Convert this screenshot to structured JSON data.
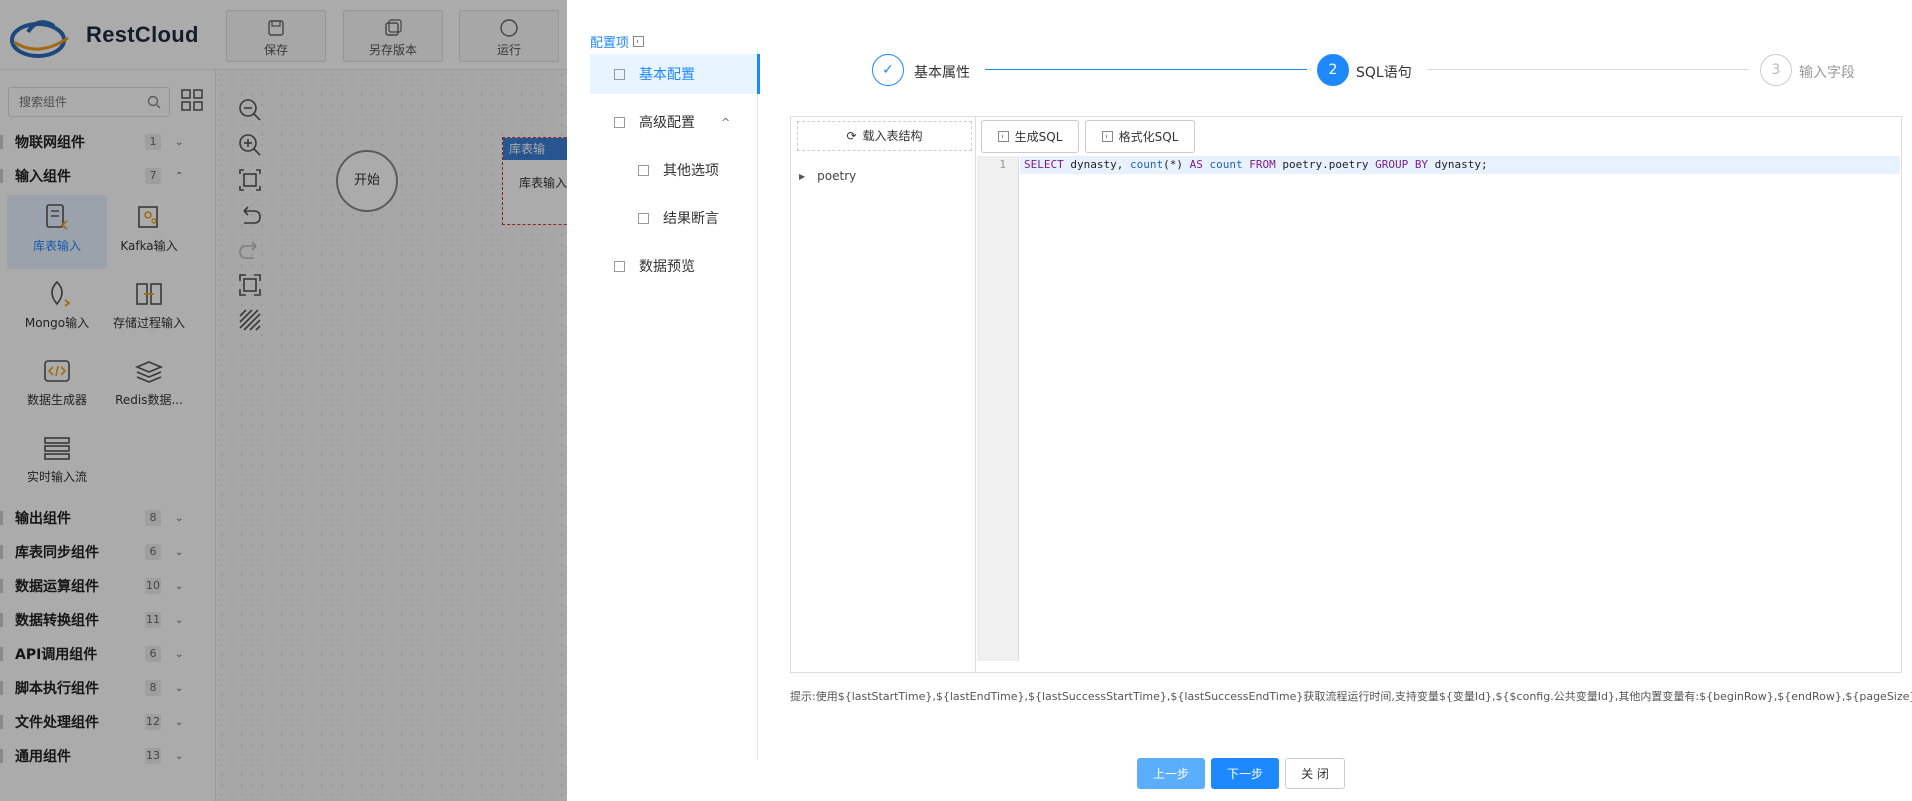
{
  "app": {
    "brand": "RestCloud",
    "toolbar": {
      "save": "保存",
      "save_as": "另存版本",
      "run": "运行"
    },
    "search_placeholder": "搜索组件",
    "categories": [
      {
        "label": "物联网组件",
        "count": "1",
        "expanded": false
      },
      {
        "label": "输入组件",
        "count": "7",
        "expanded": true
      },
      {
        "label": "输出组件",
        "count": "8",
        "expanded": false
      },
      {
        "label": "库表同步组件",
        "count": "6",
        "expanded": false
      },
      {
        "label": "数据运算组件",
        "count": "10",
        "expanded": false
      },
      {
        "label": "数据转换组件",
        "count": "11",
        "expanded": false
      },
      {
        "label": "API调用组件",
        "count": "6",
        "expanded": false
      },
      {
        "label": "脚本执行组件",
        "count": "8",
        "expanded": false
      },
      {
        "label": "文件处理组件",
        "count": "12",
        "expanded": false
      },
      {
        "label": "通用组件",
        "count": "13",
        "expanded": false
      }
    ],
    "input_components": [
      {
        "label": "库表输入",
        "icon": "table-input-icon",
        "active": true
      },
      {
        "label": "Kafka输入",
        "icon": "kafka-input-icon",
        "active": false
      },
      {
        "label": "Mongo输入",
        "icon": "mongo-input-icon",
        "active": false
      },
      {
        "label": "存储过程输入",
        "icon": "procedure-input-icon",
        "active": false
      },
      {
        "label": "数据生成器",
        "icon": "code-generator-icon",
        "active": false
      },
      {
        "label": "Redis数据...",
        "icon": "redis-icon",
        "active": false
      },
      {
        "label": "实时输入流",
        "icon": "stream-input-icon",
        "active": false
      }
    ],
    "canvas": {
      "start_node": "开始",
      "source_node_title": "库表输",
      "source_node_body": "库表输入"
    }
  },
  "dialog": {
    "config_title": "配置项",
    "nav": [
      {
        "label": "基本配置",
        "active": true,
        "indent": false
      },
      {
        "label": "高级配置",
        "active": false,
        "indent": false,
        "caret": "^"
      },
      {
        "label": "其他选项",
        "active": false,
        "indent": true
      },
      {
        "label": "结果断言",
        "active": false,
        "indent": true
      },
      {
        "label": "数据预览",
        "active": false,
        "indent": false
      }
    ],
    "steps": [
      {
        "label": "基本属性",
        "marker": "✓",
        "state": "done"
      },
      {
        "label": "SQL语句",
        "marker": "2",
        "state": "active"
      },
      {
        "label": "输入字段",
        "marker": "3",
        "state": "pending"
      }
    ],
    "load_structure": "载入表结构",
    "tree_item": "poetry",
    "generate_sql": "生成SQL",
    "format_sql": "格式化SQL",
    "line_number": "1",
    "sql": {
      "select": "SELECT",
      "body1": " dynasty, ",
      "count_fn": "count",
      "body2": "(*) ",
      "as": "AS",
      "body3": " ",
      "count_alias": "count",
      "body4": " ",
      "from": "FROM",
      "body5": " poetry.poetry ",
      "group_by": "GROUP BY",
      "body6": " dynasty;"
    },
    "hint": "提示:使用${lastStartTime},${lastEndTime},${lastSuccessStartTime},${lastSuccessEndTime}获取流程运行时间,支持变量${变量Id},${$config.公共变量Id},其他内置变量有:${beginRow},${endRow},${pageSize}",
    "buttons": {
      "prev": "上一步",
      "next": "下一步",
      "close": "关 闭"
    }
  },
  "colors": {
    "primary": "#1e88ff",
    "prev_button": "#5aaefc",
    "overlay": "rgba(0,0,0,0.33)"
  }
}
